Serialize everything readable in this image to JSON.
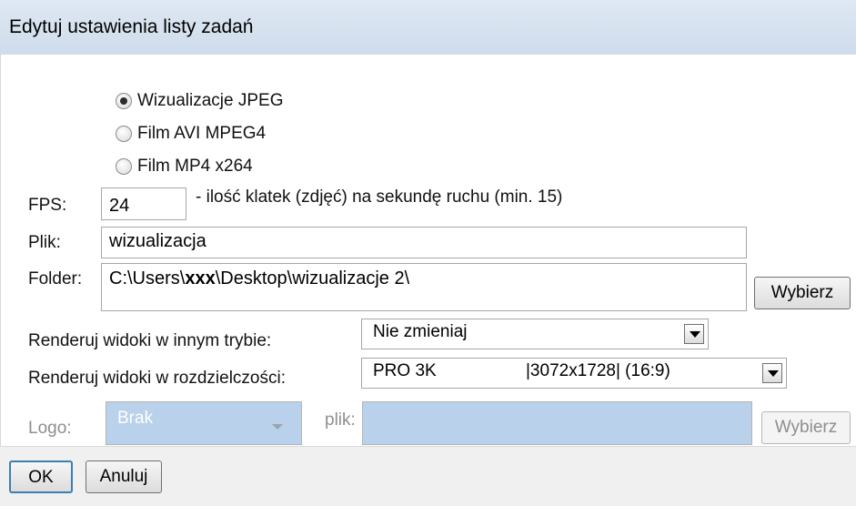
{
  "window": {
    "title": "Edytuj ustawienia listy zadań"
  },
  "format_options": [
    {
      "label": "Wizualizacje JPEG",
      "checked": true
    },
    {
      "label": "Film AVI MPEG4",
      "checked": false
    },
    {
      "label": "Film MP4 x264",
      "checked": false
    }
  ],
  "fps": {
    "label": "FPS:",
    "value": "24",
    "hint": "- ilość klatek (zdjęć) na sekundę ruchu (min. 15)"
  },
  "file": {
    "label": "Plik:",
    "value": "wizualizacja"
  },
  "folder": {
    "label": "Folder:",
    "value_pre": "C:\\Users\\",
    "value_user": "xxx",
    "value_post": "\\Desktop\\wizualizacje 2\\",
    "button": "Wybierz"
  },
  "render_mode": {
    "label": "Renderuj widoki w innym trybie:",
    "selected": "Nie zmieniaj"
  },
  "render_resolution": {
    "label": "Renderuj widoki w rozdzielczości:",
    "selected_name": "PRO 3K",
    "selected_detail": "|3072x1728| (16:9)"
  },
  "logo": {
    "label": "Logo:",
    "selected": "Brak",
    "file_label": "plik:",
    "file_value": "",
    "button": "Wybierz"
  },
  "actions": {
    "ok": "OK",
    "cancel": "Anuluj"
  }
}
